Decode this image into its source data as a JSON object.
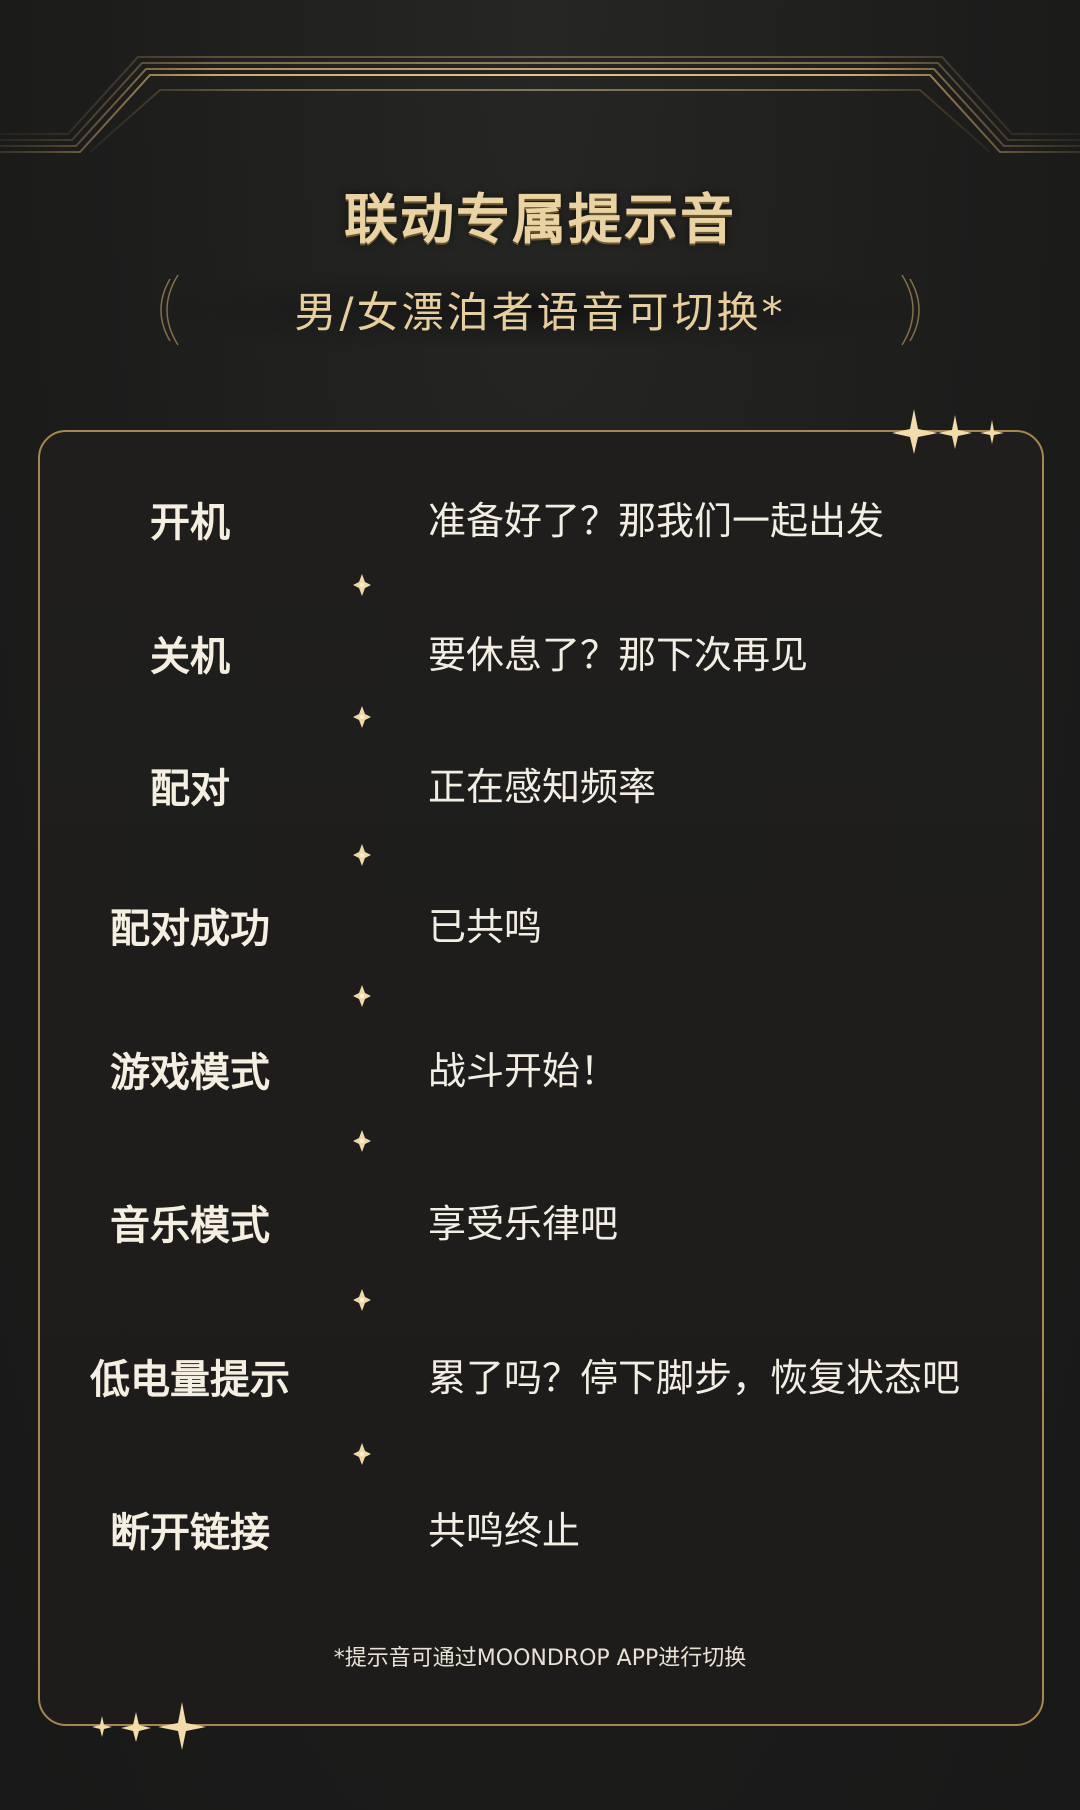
{
  "header": {
    "title": "联动专属提示音",
    "subtitle": "男/女漂泊者语音可切换*"
  },
  "prompts": [
    {
      "label": "开机",
      "text": "准备好了？那我们一起出发"
    },
    {
      "label": "关机",
      "text": "要休息了？那下次再见"
    },
    {
      "label": "配对",
      "text": "正在感知频率"
    },
    {
      "label": "配对成功",
      "text": "已共鸣"
    },
    {
      "label": "游戏模式",
      "text": "战斗开始！"
    },
    {
      "label": "音乐模式",
      "text": "享受乐律吧"
    },
    {
      "label": "低电量提示",
      "text": "累了吗？停下脚步，恢复状态吧"
    },
    {
      "label": "断开链接",
      "text": "共鸣终止"
    }
  ],
  "footnote": "*提示音可通过MOONDROP APP进行切换",
  "colors": {
    "background": "#1b1b1b",
    "gold": "#c7a566",
    "title_gold": "#e9d3a3",
    "text": "#f3eee4"
  }
}
